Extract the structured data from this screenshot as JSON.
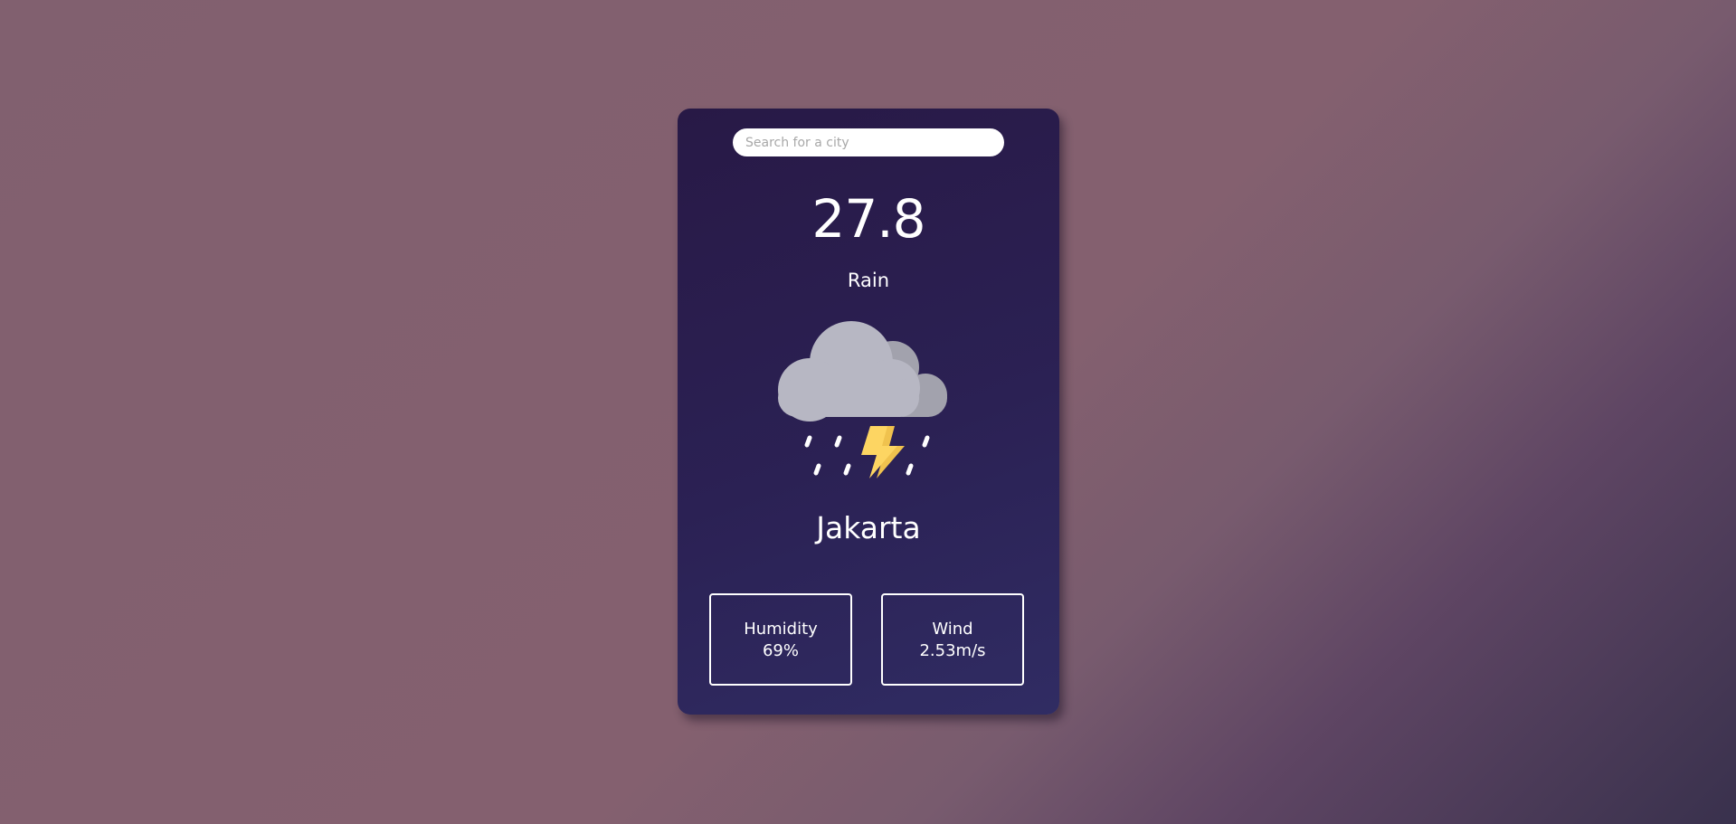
{
  "search": {
    "placeholder": "Search for a city",
    "value": ""
  },
  "weather": {
    "temperature": "27.8",
    "condition": "Rain",
    "icon": "thunderstorm-rain-icon",
    "city": "Jakarta"
  },
  "stats": {
    "humidity": {
      "label": "Humidity",
      "value": "69%"
    },
    "wind": {
      "label": "Wind",
      "value": "2.53m/s"
    }
  },
  "colors": {
    "background_start": "#84606f",
    "background_end": "#39314d",
    "card_start": "#281946",
    "card_end": "#302c63",
    "cloud_front": "#b7b7c3",
    "cloud_back": "#a2a2ad",
    "lightning": "#fdd562",
    "text": "#ffffff"
  }
}
